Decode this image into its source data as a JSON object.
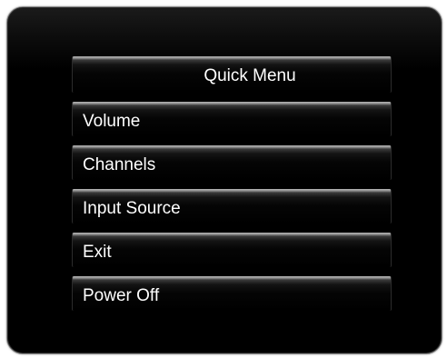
{
  "menu": {
    "title": "Quick Menu",
    "items": [
      {
        "label": "Volume"
      },
      {
        "label": "Channels"
      },
      {
        "label": "Input Source"
      },
      {
        "label": "Exit"
      },
      {
        "label": "Power Off"
      }
    ]
  }
}
